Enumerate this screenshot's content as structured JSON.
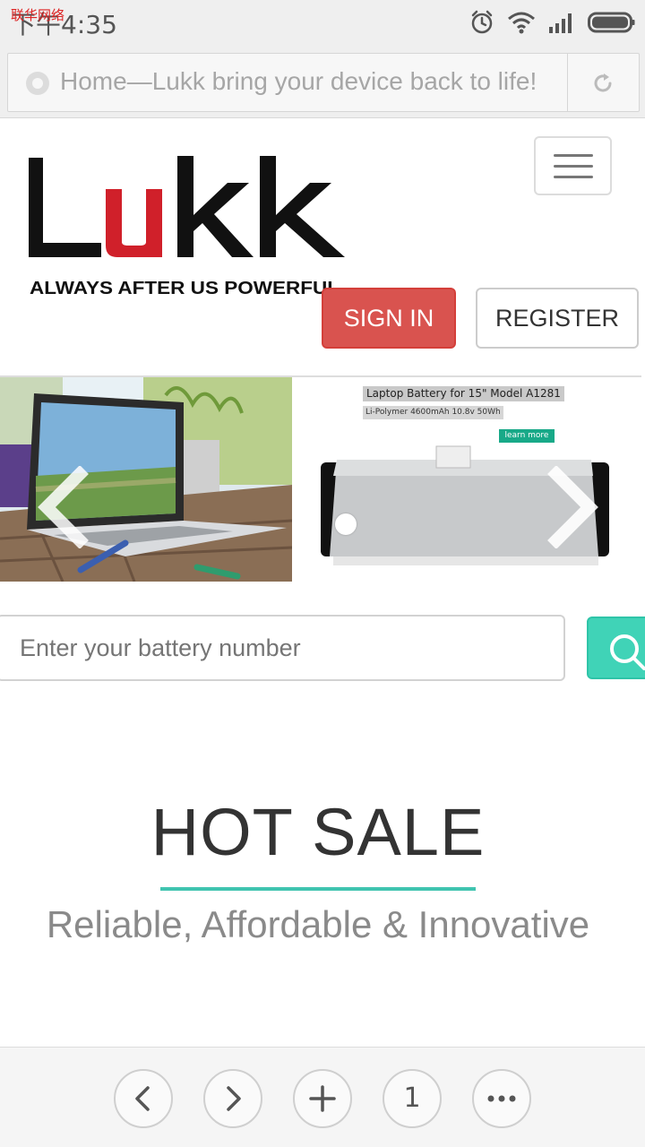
{
  "status_bar": {
    "time": "下午4:35",
    "carrier_watermark": "联华网络",
    "icons": [
      "alarm-icon",
      "wifi-icon",
      "signal-icon",
      "battery-icon"
    ]
  },
  "address_bar": {
    "title": "Home—Lukk bring your device back to life!",
    "icons": [
      "favicon-icon",
      "reload-icon"
    ]
  },
  "header": {
    "logo_text": "Lukk",
    "logo_tagline": "ALWAYS AFTER US POWERFUL",
    "sign_in_label": "SIGN IN",
    "register_label": "REGISTER",
    "menu_icon": "hamburger-menu-icon",
    "colors": {
      "sign_in": "#d9534f",
      "logo_accent": "#d0202a"
    }
  },
  "carousel": {
    "promo_title": "Laptop Battery for 15\" Model A1281",
    "promo_spec": "Li-Polymer 4600mAh 10.8v 50Wh",
    "learn_more_label": "learn more",
    "icons": [
      "chevron-left-icon",
      "chevron-right-icon"
    ]
  },
  "search": {
    "placeholder": "Enter your battery number",
    "icon": "search-icon",
    "button_color": "#40d3b7"
  },
  "hot_sale": {
    "title": "HOT SALE",
    "subtitle": "Reliable, Affordable & Innovative",
    "accent_color": "#40c4b0"
  },
  "bottom_nav": {
    "tabs_count": "1",
    "icons": [
      "back-icon",
      "forward-icon",
      "new-tab-icon",
      "tabs-icon",
      "more-icon"
    ]
  }
}
